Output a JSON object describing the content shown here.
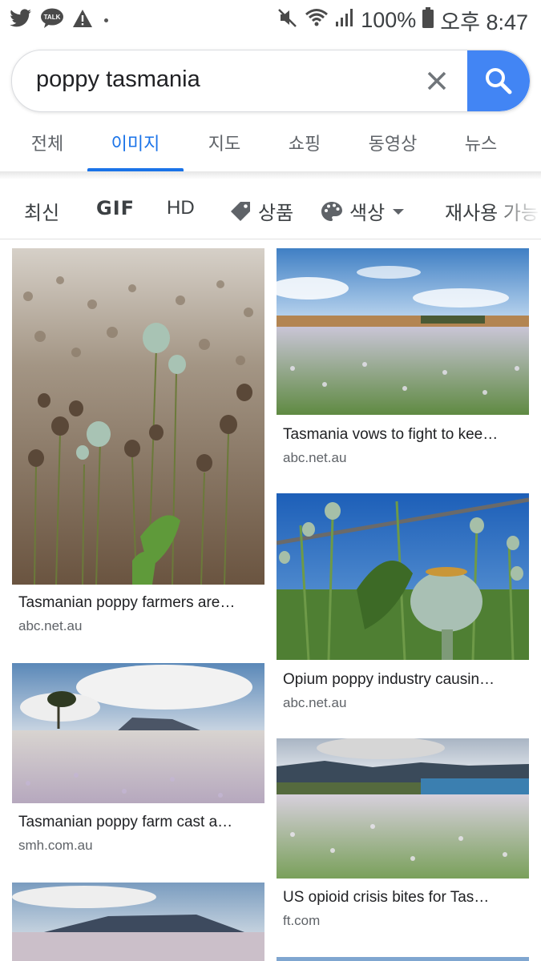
{
  "status_bar": {
    "battery": "100%",
    "time": "오후 8:47",
    "icons": [
      "twitter-icon",
      "kakaotalk-icon",
      "warning-icon",
      "mute-icon",
      "wifi-icon",
      "signal-icon",
      "battery-icon"
    ],
    "kakao_label": "TALK"
  },
  "search": {
    "query": "poppy tasmania",
    "accent": "#4285f4"
  },
  "tabs": [
    {
      "label": "전체"
    },
    {
      "label": "이미지"
    },
    {
      "label": "지도"
    },
    {
      "label": "쇼핑"
    },
    {
      "label": "동영상"
    },
    {
      "label": "뉴스"
    }
  ],
  "chips": {
    "recent": "최신",
    "gif": "GIF",
    "hd": "HD",
    "product": "상품",
    "color": "색상",
    "reuse": "재사용 가능"
  },
  "results": [
    {
      "title": "Tasmanian poppy farmers are…",
      "source": "abc.net.au"
    },
    {
      "title": "Tasmania vows to fight to kee…",
      "source": "abc.net.au"
    },
    {
      "title": "Opium poppy industry causin…",
      "source": "abc.net.au"
    },
    {
      "title": "Tasmanian poppy farm cast a…",
      "source": "smh.com.au"
    },
    {
      "title": "US opioid crisis bites for Tas…",
      "source": "ft.com"
    }
  ]
}
